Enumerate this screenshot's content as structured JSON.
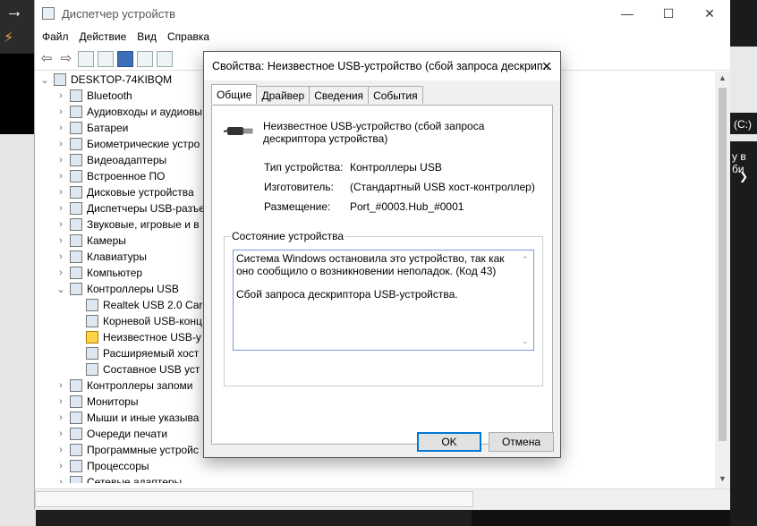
{
  "window": {
    "title": "Диспетчер устройств",
    "controls": {
      "minimize": "—",
      "maximize": "☐",
      "close": "✕"
    }
  },
  "menu": [
    "Файл",
    "Действие",
    "Вид",
    "Справка"
  ],
  "tree": {
    "root": "DESKTOP-74KIBQM",
    "items": [
      "Bluetooth",
      "Аудиовходы и аудиовы",
      "Батареи",
      "Биометрические устро",
      "Видеоадаптеры",
      "Встроенное ПО",
      "Дисковые устройства",
      "Диспетчеры USB-разъе",
      "Звуковые, игровые и в",
      "Камеры",
      "Клавиатуры",
      "Компьютер",
      "Контроллеры USB"
    ],
    "usb_children": [
      "Realtek USB 2.0 Card",
      "Корневой USB-конц",
      "Неизвестное USB-у",
      "Расширяемый хост",
      "Составное USB уст"
    ],
    "items_after": [
      "Контроллеры запоми",
      "Мониторы",
      "Мыши и иные указыва",
      "Очереди печати",
      "Программные устройс",
      "Процессоры",
      "Сетевые адаптеры"
    ]
  },
  "dialog": {
    "title": "Свойства: Неизвестное USB-устройство (сбой запроса дескрип...",
    "close": "✕",
    "tabs": [
      "Общие",
      "Драйвер",
      "Сведения",
      "События"
    ],
    "device_name": "Неизвестное USB-устройство (сбой запроса дескриптора устройства)",
    "props": [
      {
        "label": "Тип устройства:",
        "value": "Контроллеры USB"
      },
      {
        "label": "Изготовитель:",
        "value": "(Стандартный USB хост-контроллер)"
      },
      {
        "label": "Размещение:",
        "value": "Port_#0003.Hub_#0001"
      }
    ],
    "status_group_label": "Состояние устройства",
    "status_line1": "Система Windows остановила это устройство, так как оно сообщило о возникновении неполадок. (Код 43)",
    "status_line2": "Сбой запроса дескриптора USB-устройства.",
    "ok": "OK",
    "cancel": "Отмена"
  },
  "background": {
    "right_text1": "(C:)",
    "right_text2": "у в би",
    "right_text3": "❯"
  }
}
